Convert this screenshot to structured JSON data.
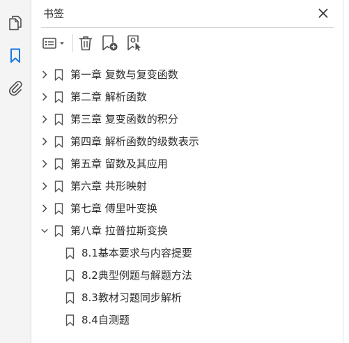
{
  "panel": {
    "title": "书签"
  },
  "rail": {
    "items": [
      {
        "icon": "pages-icon"
      },
      {
        "icon": "bookmark-icon",
        "active": true
      },
      {
        "icon": "attachment-icon"
      }
    ]
  },
  "toolbar": {
    "buttons": [
      "options-menu-icon",
      "delete-icon",
      "new-bookmark-icon",
      "bookmark-from-selection-icon"
    ]
  },
  "bookmarks": {
    "items": [
      {
        "label": "第一章  复数与复变函数",
        "expanded": false
      },
      {
        "label": "第二章  解析函数",
        "expanded": false
      },
      {
        "label": "第三章  复变函数的积分",
        "expanded": false
      },
      {
        "label": "第四章  解析函数的级数表示",
        "expanded": false
      },
      {
        "label": "第五章  留数及其应用",
        "expanded": false
      },
      {
        "label": "第六章  共形映射",
        "expanded": false
      },
      {
        "label": "第七章  傅里叶变换",
        "expanded": false
      },
      {
        "label": "第八章  拉普拉斯变换",
        "expanded": true
      }
    ],
    "children": [
      {
        "label": "8.1基本要求与内容提要"
      },
      {
        "label": "8.2典型例题与解题方法"
      },
      {
        "label": "8.3教材习题同步解析"
      },
      {
        "label": "8.4自测题"
      }
    ]
  },
  "colors": {
    "accent": "#1473e6",
    "icon": "#505050",
    "rail_bg": "#f4f4f4"
  }
}
